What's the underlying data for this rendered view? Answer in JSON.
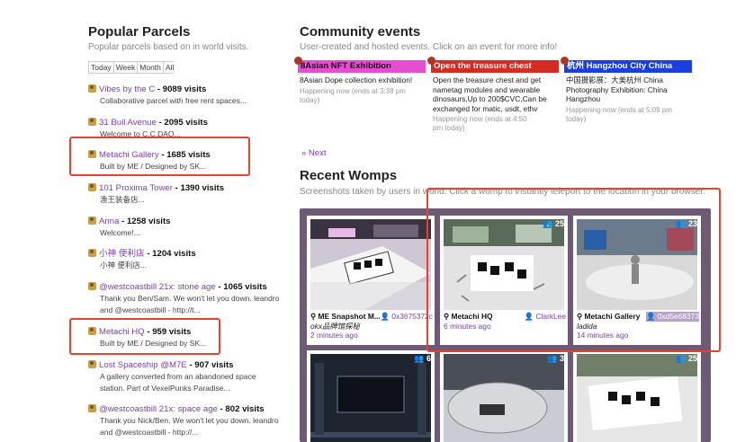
{
  "parcels": {
    "title": "Popular Parcels",
    "subtitle": "Popular parcels based on in world visits.",
    "tabs": [
      "Today",
      "Week",
      "Month",
      "All"
    ],
    "items": [
      {
        "name": "Vibes by the C",
        "visits": "- 9089 visits",
        "desc": "Collaborative parcel with free rent spaces..."
      },
      {
        "name": "31 Bull Avenue",
        "visits": "- 2095 visits",
        "desc": "Welcome to C.C.DAO..."
      },
      {
        "name": "Metachi Gallery",
        "visits": "- 1685 visits",
        "desc": "Built by ME / Designed by SK..."
      },
      {
        "name": "101 Proxima Tower",
        "visits": "- 1390 visits",
        "desc": "渔王装备店..."
      },
      {
        "name": "Anna",
        "visits": "- 1258 visits",
        "desc": "Welcome!..."
      },
      {
        "name": "小神 便利店",
        "visits": "- 1204 visits",
        "desc": "小神 便利店..."
      },
      {
        "name": "@westcoastbill 21x: stone age",
        "visits": "- 1065 visits",
        "desc": "Thank you Ben/Sam. We won't let you down. leandro and @westcoastbill - http://t..."
      },
      {
        "name": "Metachi HQ",
        "visits": "- 959 visits",
        "desc": "Built by ME / Designed by SK..."
      },
      {
        "name": "Lost Spaceship @M7E",
        "visits": "- 907 visits",
        "desc": "A gallery converted from an abandoned space station. Part of VexelPunks Paradise..."
      },
      {
        "name": "@westcoastbill 21x: space age",
        "visits": "- 802 visits",
        "desc": "Thank you Nick/Ben. We won't let you down. leandro and @westcoastbill - http://..."
      }
    ]
  },
  "events": {
    "title": "Community events",
    "subtitle": "User-created and hosted events. Click on an event for more info!",
    "items": [
      {
        "name": "8Asian NFT Exhibition",
        "color": "#e64ed1",
        "desc": "8Asian Dope collection exhibition!",
        "time": "Happening now (ends at 3:38 pm today)"
      },
      {
        "name": "Open the treasure chest",
        "color": "#d42b22",
        "desc": "Open the treasure chest and get nametag modules and wearable dinosaurs,Up to 200$CVC,Can be exchanged for matic, usdt, ethv",
        "time": "Happening now (ends at 4:50 pm today)"
      },
      {
        "name": "杭州 Hangzhou City China",
        "color": "#1a3fe0",
        "desc": "中国摄影展：大美杭州 China Photography Exhibition: China Hangzhou",
        "time": "Happening now (ends at 5:09 pm today)"
      }
    ],
    "next": "» Next"
  },
  "womps": {
    "title": "Recent Womps",
    "subtitle": "Screenshots taken by users in world. Click a womp to instantly teleport to the location in your browser.",
    "items": [
      {
        "location": "ME Snapshot M...",
        "user": "0x3675372c",
        "caption": "okx品牌馆探秘",
        "ago": "2 minutes ago",
        "count": ""
      },
      {
        "location": "Metachi HQ",
        "user": "ClarkLee",
        "caption": "",
        "ago": "6 minutes ago",
        "count": "25"
      },
      {
        "location": "Metachi Gallery",
        "user": "0xd5e68373",
        "caption": "ladida",
        "ago": "14 minutes ago",
        "count": "23"
      },
      {
        "location": "",
        "user": "",
        "caption": "",
        "ago": "",
        "count": "6"
      },
      {
        "location": "",
        "user": "",
        "caption": "",
        "ago": "",
        "count": "3"
      },
      {
        "location": "",
        "user": "",
        "caption": "",
        "ago": "",
        "count": "25"
      }
    ]
  }
}
